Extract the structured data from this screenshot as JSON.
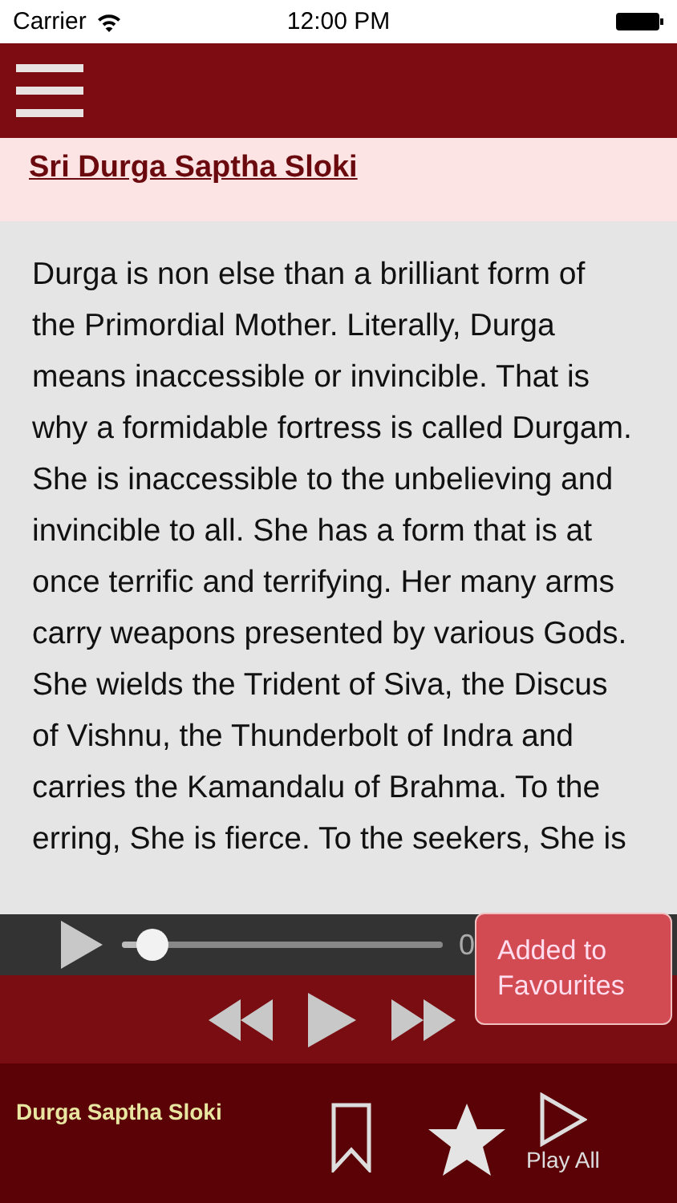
{
  "status_bar": {
    "carrier": "Carrier",
    "time": "12:00 PM"
  },
  "title": "Sri Durga Saptha Sloki",
  "body": "Durga is non else than a brilliant form of the Primordial Mother. Literally, Durga means inaccessible or invincible. That is why a formidable fortress is called Durgam. She is inaccessible to the unbelieving and invincible to all. She has a form that is at once terrific and terrifying. Her many arms carry weapons presented by various Gods. She wields the Trident of Siva, the Discus of Vishnu, the Thunderbolt of Indra and carries the Kamandalu of Brahma. To the erring, She is fierce. To the seekers, She is",
  "player": {
    "level": 0.05,
    "time": "0"
  },
  "toast": "Added to Favourites",
  "bottom_bar": {
    "track": "Durga Saptha Sloki",
    "play_all": "Play All"
  }
}
